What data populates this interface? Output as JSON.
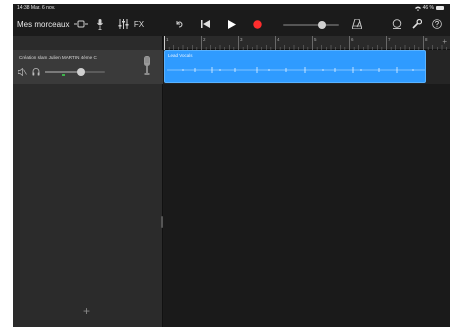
{
  "status": {
    "time_date": "14:38  Mar. 6 nov.",
    "battery": "46 %"
  },
  "toolbar": {
    "songs_label": "Mes morceaux",
    "fx_label": "FX",
    "icons": [
      "browser-icon",
      "mic-icon",
      "mixer-icon",
      "fx-icon",
      "undo-icon",
      "rewind-icon",
      "play-icon",
      "record-icon",
      "metronome-icon",
      "loop-icon",
      "wrench-icon",
      "help-icon"
    ],
    "record_color": "#ff2d2d"
  },
  "track": {
    "name": "Création slam Julien MARTIN 4ème C",
    "volume": 0.6
  },
  "ruler": {
    "bars": [
      "1",
      "2",
      "3",
      "4",
      "5",
      "6",
      "7",
      "8"
    ]
  },
  "region": {
    "name": "Lead Vocals",
    "color": "#2f9bff"
  },
  "add_label": "+"
}
